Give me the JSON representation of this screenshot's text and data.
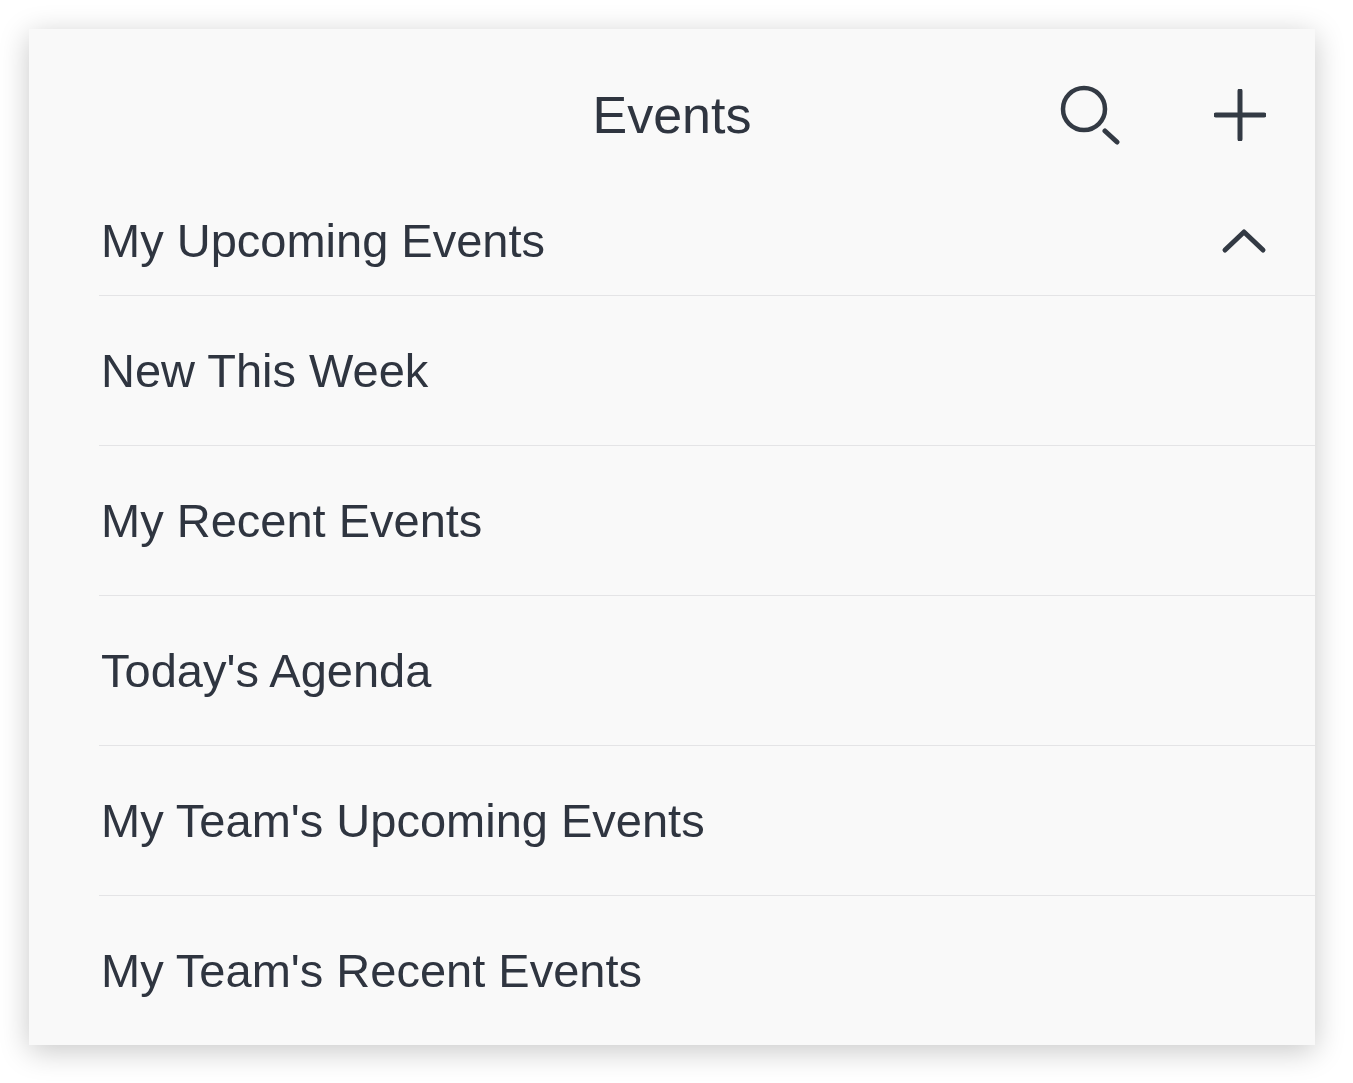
{
  "header": {
    "title": "Events"
  },
  "section": {
    "label": "My Upcoming Events",
    "expanded": true
  },
  "items": [
    {
      "label": "New This Week"
    },
    {
      "label": "My Recent Events"
    },
    {
      "label": "Today's Agenda"
    },
    {
      "label": "My Team's Upcoming Events"
    },
    {
      "label": "My Team's Recent Events"
    }
  ]
}
